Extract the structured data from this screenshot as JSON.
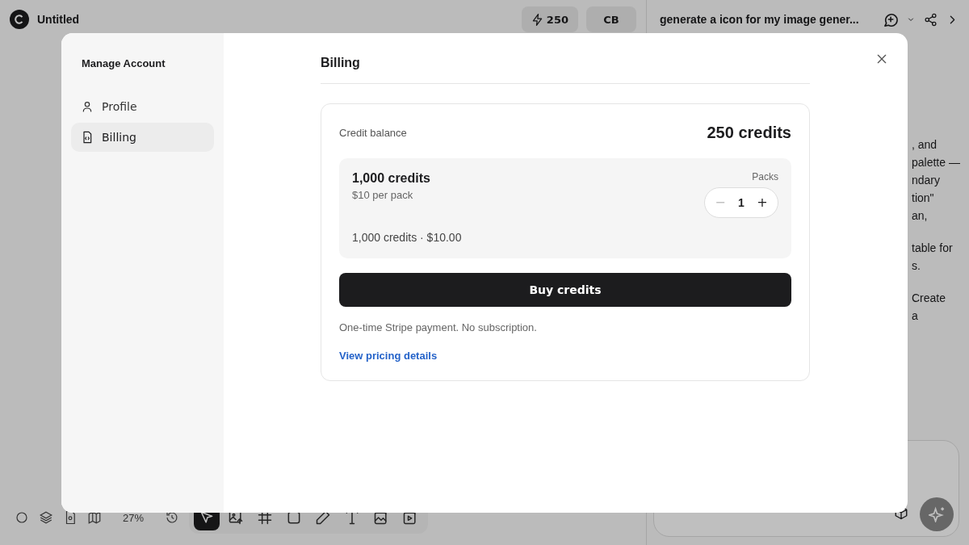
{
  "app_bar": {
    "title": "Untitled",
    "credits": "250",
    "avatar": "CB"
  },
  "chat": {
    "title": "generate a icon for my image gener...",
    "paragraphs": [
      [
        ", and",
        "palette —",
        "ndary",
        "tion\"",
        "an,"
      ],
      [
        "table for",
        "s."
      ],
      [
        "Create",
        "a"
      ]
    ]
  },
  "toolbar": {
    "zoom": "27%",
    "tools": [
      {
        "kind": "select",
        "selected": true
      },
      {
        "kind": "image-upload",
        "selected": false
      },
      {
        "kind": "frame",
        "selected": false
      },
      {
        "kind": "rectangle",
        "selected": false
      },
      {
        "kind": "pencil",
        "selected": false
      },
      {
        "kind": "text",
        "selected": false
      },
      {
        "kind": "image-generate",
        "selected": false
      },
      {
        "kind": "video-generate",
        "selected": false
      }
    ]
  },
  "modal": {
    "sidebar_title": "Manage Account",
    "nav": [
      {
        "label": "Profile",
        "kind": "profile",
        "selected": false
      },
      {
        "label": "Billing",
        "kind": "billing",
        "selected": true
      }
    ],
    "heading": "Billing",
    "balance_label": "Credit balance",
    "balance": "250 credits",
    "pack": {
      "title": "1,000 credits",
      "price": "$10 per pack",
      "packs_label": "Packs",
      "quantity": "1",
      "decrement": "−",
      "increment": "+",
      "decrement_disabled": true,
      "summary": "1,000 credits · $10.00"
    },
    "buy_button": "Buy credits",
    "note": "One-time Stripe payment. No subscription.",
    "link": "View pricing details"
  }
}
